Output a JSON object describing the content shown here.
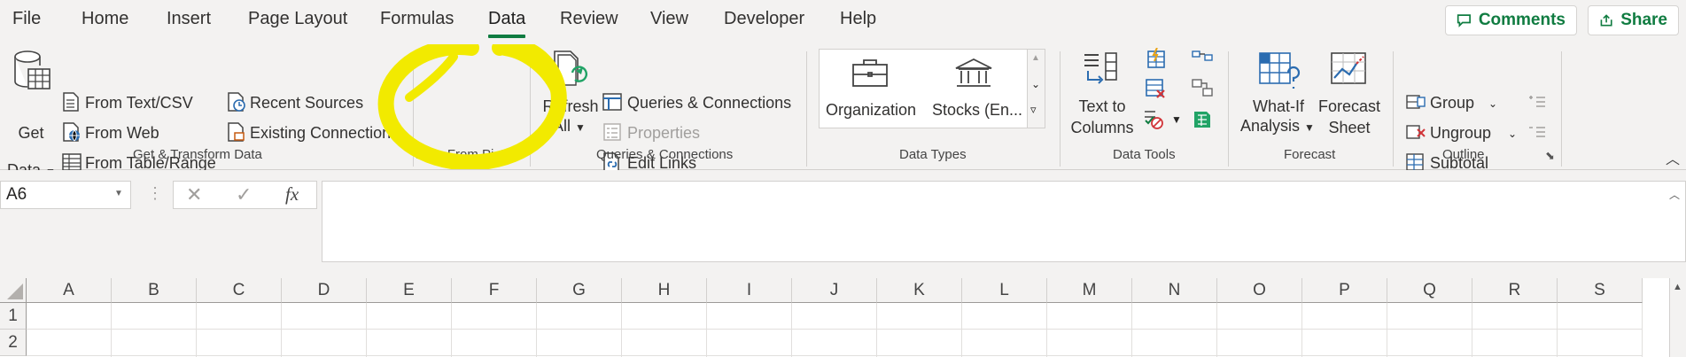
{
  "tabs": [
    {
      "label": "File"
    },
    {
      "label": "Home"
    },
    {
      "label": "Insert"
    },
    {
      "label": "Page Layout"
    },
    {
      "label": "Formulas"
    },
    {
      "label": "Data"
    },
    {
      "label": "Review"
    },
    {
      "label": "View"
    },
    {
      "label": "Developer"
    },
    {
      "label": "Help"
    }
  ],
  "active_tab": "Data",
  "top_buttons": {
    "comments": "Comments",
    "share": "Share"
  },
  "ribbon": {
    "get_transform": {
      "get_data_line1": "Get",
      "get_data_line2": "Data",
      "from_text_csv": "From Text/CSV",
      "from_web": "From Web",
      "from_table_range": "From Table/Range",
      "recent_sources": "Recent Sources",
      "existing_connections": "Existing Connections",
      "group_label": "Get & Transform Data"
    },
    "data_from_picture": {
      "group_label": "Data From Picture"
    },
    "queries": {
      "refresh_line1": "Refresh",
      "refresh_line2": "All",
      "queries_connections": "Queries & Connections",
      "properties": "Properties",
      "edit_links": "Edit Links",
      "group_label": "Queries & Connections"
    },
    "data_types": {
      "organization": "Organization",
      "stocks": "Stocks (En...",
      "group_label": "Data Types"
    },
    "data_tools": {
      "text_to_line1": "Text to",
      "text_to_line2": "Columns",
      "group_label": "Data Tools"
    },
    "forecast": {
      "what_if_line1": "What-If",
      "what_if_line2": "Analysis",
      "forecast_line1": "Forecast",
      "forecast_line2": "Sheet",
      "group_label": "Forecast"
    },
    "outline": {
      "group": "Group",
      "ungroup": "Ungroup",
      "subtotal": "Subtotal",
      "group_label": "Outline"
    }
  },
  "formula_bar": {
    "name_box": "A6",
    "fx_label": "fx",
    "cancel_symbol": "✕",
    "enter_symbol": "✓",
    "formula": ""
  },
  "grid": {
    "columns": [
      "A",
      "B",
      "C",
      "D",
      "E",
      "F",
      "G",
      "H",
      "I",
      "J",
      "K",
      "L",
      "M",
      "N",
      "O",
      "P",
      "Q",
      "R",
      "S"
    ],
    "rows": [
      "1",
      "2"
    ]
  },
  "annotation": {
    "color": "#f2ea00"
  },
  "colors": {
    "accent": "#107c41",
    "blue_icon": "#2b6cb0"
  }
}
